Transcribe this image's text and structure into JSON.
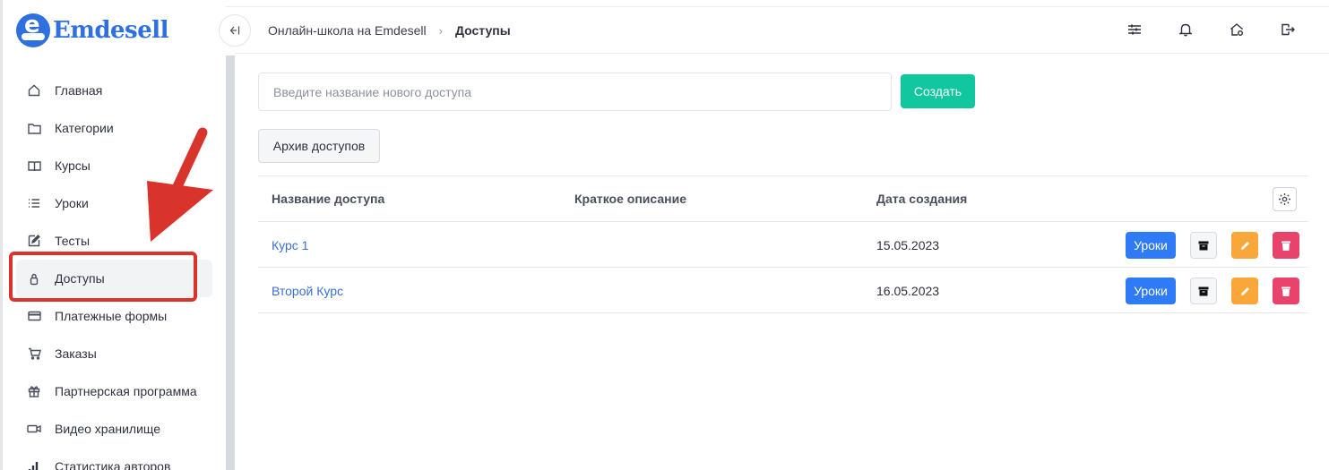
{
  "brand": {
    "name": "Emdesell",
    "logo_letter": "e"
  },
  "sidebar": {
    "items": [
      {
        "label": "Главная",
        "icon": "home-icon"
      },
      {
        "label": "Категории",
        "icon": "folder-icon"
      },
      {
        "label": "Курсы",
        "icon": "book-icon"
      },
      {
        "label": "Уроки",
        "icon": "list-icon"
      },
      {
        "label": "Тесты",
        "icon": "edit-icon"
      },
      {
        "label": "Доступы",
        "icon": "lock-icon",
        "active": true
      },
      {
        "label": "Платежные формы",
        "icon": "credit-card-icon"
      },
      {
        "label": "Заказы",
        "icon": "cart-icon"
      },
      {
        "label": "Партнерская программа",
        "icon": "gift-icon"
      },
      {
        "label": "Видео хранилище",
        "icon": "video-icon"
      },
      {
        "label": "Статистика авторов",
        "icon": "chart-icon"
      }
    ]
  },
  "header": {
    "collapse_icon": "collapse-sidebar-icon",
    "breadcrumb": {
      "root": "Онлайн-школа на Emdesell",
      "current": "Доступы"
    },
    "icons": [
      "sliders-icon",
      "bell-icon",
      "house-settings-icon",
      "logout-icon"
    ]
  },
  "form": {
    "placeholder": "Введите название нового доступа",
    "value": "",
    "create_label": "Создать",
    "archive_label": "Архив доступов"
  },
  "table": {
    "columns": {
      "name": "Название доступа",
      "description": "Краткое описание",
      "date": "Дата создания"
    },
    "rows": [
      {
        "name": "Курс 1",
        "description": "",
        "date": "15.05.2023",
        "lessons_label": "Уроки"
      },
      {
        "name": "Второй Курс",
        "description": "",
        "date": "16.05.2023",
        "lessons_label": "Уроки"
      }
    ]
  },
  "colors": {
    "brand": "#2f6fe0",
    "create": "#10c7a0",
    "lessons": "#2f7bf5",
    "edit": "#f9a63a",
    "delete": "#e8436a",
    "annotation": "#d9342b"
  }
}
